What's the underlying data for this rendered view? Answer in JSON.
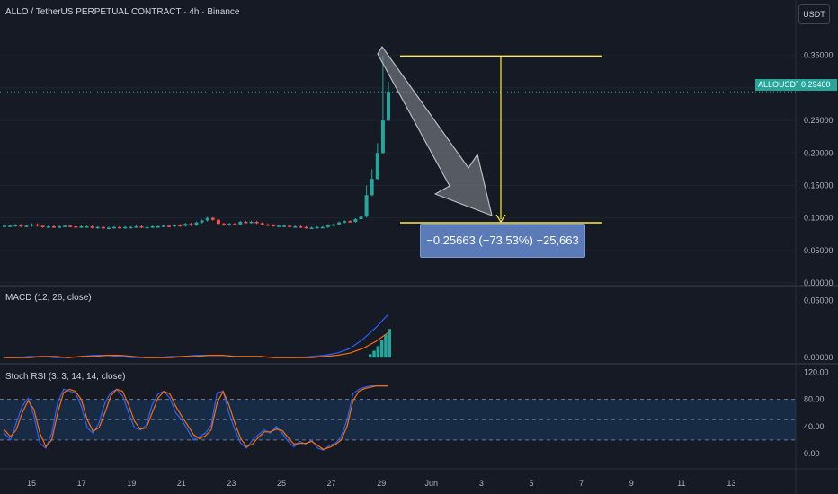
{
  "header": {
    "symbol_title": "ALLO / TetherUS PERPETUAL CONTRACT · 4h · Binance",
    "currency_button": "USDT"
  },
  "price_axis": {
    "ticks": [
      "0.35000",
      "0.30000",
      "0.25000",
      "0.20000",
      "0.15000",
      "0.10000",
      "0.05000",
      "0.00000"
    ],
    "tick_values": [
      0.35,
      0.3,
      0.25,
      0.2,
      0.15,
      0.1,
      0.05,
      0.0
    ],
    "symbol_tag": "ALLOUSDT.P",
    "last_price_tag": "0.29400",
    "last_price": 0.294
  },
  "measure": {
    "label": "−0.25663 (−73.53%) −25,663",
    "top_price": 0.349,
    "bottom_price": 0.0925
  },
  "macd": {
    "label": "MACD (12, 26, close)",
    "ticks": [
      "0.05000",
      "0.00000"
    ],
    "tick_values": [
      0.05,
      0.0
    ]
  },
  "stoch": {
    "label": "Stoch RSI (3, 3, 14, 14, close)",
    "ticks": [
      "120.00",
      "80.00",
      "40.00",
      "0.00"
    ],
    "tick_values": [
      120,
      80,
      40,
      0
    ]
  },
  "time_axis": {
    "labels": [
      "15",
      "17",
      "19",
      "21",
      "23",
      "25",
      "27",
      "29",
      "Jun",
      "3",
      "5",
      "7",
      "9",
      "11",
      "13"
    ]
  },
  "colors": {
    "up": "#26a69a",
    "down": "#ef5350",
    "macd_line": "#2962ff",
    "signal_line": "#ff6d00",
    "measure_line": "#ffeb3b",
    "band": "#1c3a5e"
  },
  "chart_data": [
    {
      "type": "candlestick",
      "title": "ALLO / TetherUS PERPETUAL CONTRACT · 4h · Binance",
      "ylim": [
        0,
        0.38
      ],
      "x_labels": [
        "15",
        "17",
        "19",
        "21",
        "23",
        "25",
        "27",
        "29",
        "Jun",
        "3",
        "5",
        "7",
        "9",
        "11",
        "13"
      ],
      "close": [
        0.088,
        0.088,
        0.089,
        0.087,
        0.088,
        0.09,
        0.088,
        0.086,
        0.087,
        0.086,
        0.087,
        0.088,
        0.087,
        0.086,
        0.087,
        0.087,
        0.085,
        0.086,
        0.084,
        0.085,
        0.086,
        0.085,
        0.086,
        0.086,
        0.087,
        0.086,
        0.086,
        0.087,
        0.087,
        0.088,
        0.087,
        0.089,
        0.088,
        0.091,
        0.089,
        0.093,
        0.096,
        0.1,
        0.097,
        0.091,
        0.089,
        0.091,
        0.09,
        0.094,
        0.093,
        0.094,
        0.092,
        0.09,
        0.089,
        0.088,
        0.088,
        0.088,
        0.087,
        0.087,
        0.086,
        0.085,
        0.085,
        0.086,
        0.086,
        0.089,
        0.09,
        0.093,
        0.095,
        0.094,
        0.098,
        0.102,
        0.135,
        0.16,
        0.2,
        0.25,
        0.294
      ],
      "annotation": "−0.25663 (−73.53%) −25,663"
    },
    {
      "type": "line",
      "title": "MACD (12, 26, close)",
      "ylim": [
        -0.003,
        0.055
      ],
      "series": [
        {
          "values": [
            0.0,
            0.0,
            0.001,
            0.001,
            0.0,
            0.0,
            0.001,
            0.002,
            0.002,
            0.001,
            0.0,
            0.0,
            0.0,
            0.001,
            0.001,
            0.002,
            0.002,
            0.002,
            0.001,
            0.001,
            0.001,
            0.0,
            0.0,
            0.0,
            0.001,
            0.002,
            0.004,
            0.008,
            0.016,
            0.026,
            0.038
          ]
        },
        {
          "values": [
            0.0,
            0.0,
            0.0,
            0.001,
            0.001,
            0.0,
            0.001,
            0.001,
            0.002,
            0.002,
            0.001,
            0.0,
            0.0,
            0.0,
            0.001,
            0.001,
            0.002,
            0.002,
            0.001,
            0.001,
            0.001,
            0.0,
            0.0,
            0.0,
            0.0,
            0.001,
            0.002,
            0.004,
            0.008,
            0.014,
            0.022
          ]
        }
      ],
      "histogram": [
        0.003,
        0.006,
        0.01,
        0.015,
        0.02,
        0.025
      ]
    },
    {
      "type": "line",
      "title": "Stoch RSI (3, 3, 14, 14, close)",
      "ylim": [
        -20,
        130
      ],
      "bands": [
        20,
        50,
        80
      ],
      "series": [
        {
          "values": [
            30,
            20,
            45,
            70,
            82,
            55,
            15,
            8,
            30,
            75,
            95,
            92,
            90,
            70,
            38,
            30,
            45,
            75,
            90,
            95,
            85,
            60,
            38,
            35,
            42,
            72,
            88,
            92,
            82,
            60,
            50,
            35,
            20,
            25,
            30,
            42,
            90,
            92,
            60,
            35,
            15,
            8,
            20,
            28,
            35,
            30,
            40,
            30,
            18,
            10,
            18,
            14,
            20,
            8,
            5,
            12,
            15,
            25,
            50,
            88,
            95,
            98,
            100,
            100,
            100,
            100
          ]
        },
        {
          "values": [
            35,
            25,
            35,
            60,
            78,
            65,
            30,
            10,
            20,
            60,
            90,
            95,
            92,
            80,
            50,
            33,
            38,
            60,
            85,
            95,
            92,
            72,
            48,
            36,
            38,
            60,
            82,
            92,
            88,
            70,
            55,
            42,
            28,
            22,
            26,
            35,
            75,
            92,
            72,
            45,
            22,
            10,
            14,
            24,
            32,
            32,
            36,
            34,
            24,
            14,
            15,
            15,
            18,
            12,
            6,
            9,
            13,
            20,
            40,
            78,
            92,
            96,
            98,
            100,
            100,
            100
          ]
        }
      ]
    }
  ]
}
